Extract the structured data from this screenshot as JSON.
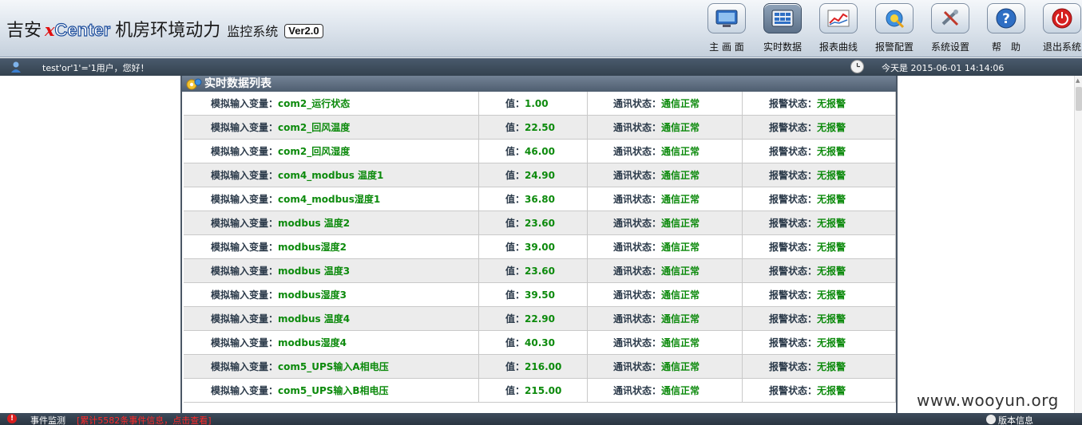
{
  "header": {
    "brand_prefix": "吉安",
    "brand_x": "x",
    "brand_center": "Center",
    "brand_main": "机房环境动力",
    "brand_sub": "监控系统",
    "version": "Ver2.0"
  },
  "nav": [
    {
      "label": "主 画 面",
      "icon": "monitor-icon",
      "active": false
    },
    {
      "label": "实时数据",
      "icon": "grid-data-icon",
      "active": true
    },
    {
      "label": "报表曲线",
      "icon": "line-chart-icon",
      "active": false
    },
    {
      "label": "报警配置",
      "icon": "alarm-config-icon",
      "active": false
    },
    {
      "label": "系统设置",
      "icon": "tools-icon",
      "active": false
    },
    {
      "label": "帮　助",
      "icon": "help-icon",
      "active": false
    },
    {
      "label": "退出系统",
      "icon": "power-icon",
      "active": false
    }
  ],
  "userbar": {
    "greeting": "test'or'1'='1用户，您好！",
    "date": "今天是 2015-06-01 14:14:06"
  },
  "panel": {
    "title": "实时数据列表"
  },
  "rows": [
    {
      "var_label": "模拟输入变量：",
      "var_name": "com2_运行状态",
      "value_label": "值：",
      "value": "1.00",
      "comm_label": "通讯状态：",
      "comm": "通信正常",
      "alarm_label": "报警状态：",
      "alarm": "无报警"
    },
    {
      "var_label": "模拟输入变量：",
      "var_name": "com2_回风温度",
      "value_label": "值：",
      "value": "22.50",
      "comm_label": "通讯状态：",
      "comm": "通信正常",
      "alarm_label": "报警状态：",
      "alarm": "无报警"
    },
    {
      "var_label": "模拟输入变量：",
      "var_name": "com2_回风湿度",
      "value_label": "值：",
      "value": "46.00",
      "comm_label": "通讯状态：",
      "comm": "通信正常",
      "alarm_label": "报警状态：",
      "alarm": "无报警"
    },
    {
      "var_label": "模拟输入变量：",
      "var_name": "com4_modbus 温度1",
      "value_label": "值：",
      "value": "24.90",
      "comm_label": "通讯状态：",
      "comm": "通信正常",
      "alarm_label": "报警状态：",
      "alarm": "无报警"
    },
    {
      "var_label": "模拟输入变量：",
      "var_name": "com4_modbus湿度1",
      "value_label": "值：",
      "value": "36.80",
      "comm_label": "通讯状态：",
      "comm": "通信正常",
      "alarm_label": "报警状态：",
      "alarm": "无报警"
    },
    {
      "var_label": "模拟输入变量：",
      "var_name": "modbus 温度2",
      "value_label": "值：",
      "value": "23.60",
      "comm_label": "通讯状态：",
      "comm": "通信正常",
      "alarm_label": "报警状态：",
      "alarm": "无报警"
    },
    {
      "var_label": "模拟输入变量：",
      "var_name": "modbus湿度2",
      "value_label": "值：",
      "value": "39.00",
      "comm_label": "通讯状态：",
      "comm": "通信正常",
      "alarm_label": "报警状态：",
      "alarm": "无报警"
    },
    {
      "var_label": "模拟输入变量：",
      "var_name": "modbus 温度3",
      "value_label": "值：",
      "value": "23.60",
      "comm_label": "通讯状态：",
      "comm": "通信正常",
      "alarm_label": "报警状态：",
      "alarm": "无报警"
    },
    {
      "var_label": "模拟输入变量：",
      "var_name": "modbus湿度3",
      "value_label": "值：",
      "value": "39.50",
      "comm_label": "通讯状态：",
      "comm": "通信正常",
      "alarm_label": "报警状态：",
      "alarm": "无报警"
    },
    {
      "var_label": "模拟输入变量：",
      "var_name": "modbus 温度4",
      "value_label": "值：",
      "value": "22.90",
      "comm_label": "通讯状态：",
      "comm": "通信正常",
      "alarm_label": "报警状态：",
      "alarm": "无报警"
    },
    {
      "var_label": "模拟输入变量：",
      "var_name": "modbus湿度4",
      "value_label": "值：",
      "value": "40.30",
      "comm_label": "通讯状态：",
      "comm": "通信正常",
      "alarm_label": "报警状态：",
      "alarm": "无报警"
    },
    {
      "var_label": "模拟输入变量：",
      "var_name": "com5_UPS输入A相电压",
      "value_label": "值：",
      "value": "216.00",
      "comm_label": "通讯状态：",
      "comm": "通信正常",
      "alarm_label": "报警状态：",
      "alarm": "无报警"
    },
    {
      "var_label": "模拟输入变量：",
      "var_name": "com5_UPS输入B相电压",
      "value_label": "值：",
      "value": "215.00",
      "comm_label": "通讯状态：",
      "comm": "通信正常",
      "alarm_label": "报警状态：",
      "alarm": "无报警"
    }
  ],
  "watermark": "www.wooyun.org",
  "statusbar": {
    "event_label": "事件监测",
    "event_link": "[累计5582条事件信息，点击查看]",
    "version_info": "版本信息"
  },
  "colors": {
    "ok_green": "#0c8a0c",
    "alert_red": "#ff2a2a",
    "header_dark": "#34424f"
  }
}
